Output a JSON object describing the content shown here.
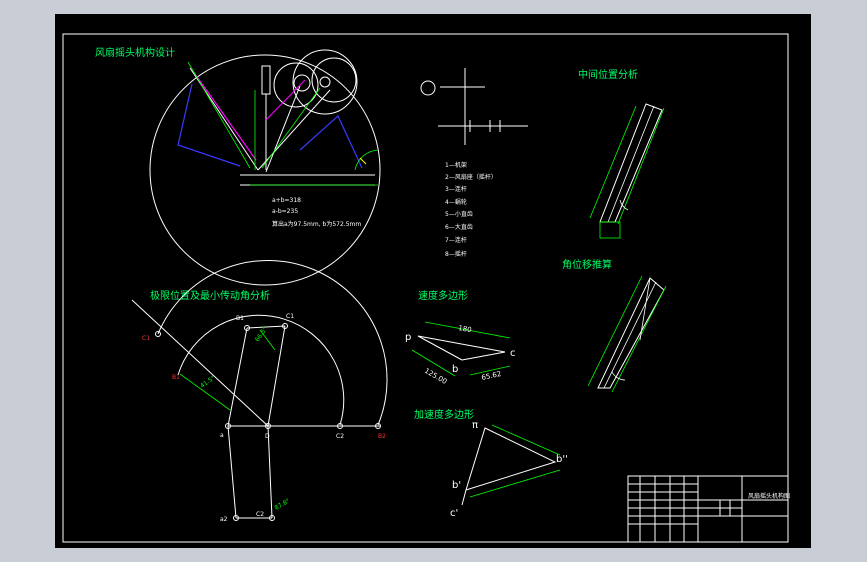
{
  "colors": {
    "background": "#c9ced6",
    "sheet": "#000000",
    "line": "#ffffff",
    "dimension": "#00ff00",
    "label_green": "#00ff66",
    "red_label": "#ff3030",
    "blue_link": "#3a3aff",
    "magenta_link": "#ff00ff",
    "yellow": "#ffff00"
  },
  "titles": {
    "main_design": "风扇摇头机构设计",
    "middle_position": "中间位置分析",
    "angular_displacement": "角位移推算",
    "limit_position": "极限位置及最小传动角分析",
    "velocity_polygon": "速度多边形",
    "acceleration_polygon": "加速度多边形"
  },
  "equations": {
    "eq1": "a+b=318",
    "eq2": "a-b=235",
    "eq3": "算出a为97.5mm, b为572.5mm"
  },
  "legend": [
    "1—机架",
    "2—风扇座（摇杆）",
    "3—连杆",
    "4—蜗轮",
    "5—小直齿",
    "6—大直齿",
    "7—连杆",
    "8—摇杆"
  ],
  "limit_labels": {
    "C1_left": "C1",
    "B1_left": "B1",
    "B1_top": "B1",
    "C1_top": "C1",
    "a": "a",
    "D": "D",
    "C2": "C2",
    "B2": "B2",
    "a2": "a2",
    "C2_bottom": "C2",
    "angle1": "66.5°",
    "angle2": "41.5°",
    "angle3": "87.8°"
  },
  "velocity": {
    "p": "p",
    "b": "b",
    "c": "c",
    "pc": "180",
    "pb": "125.00",
    "bc": "65.62"
  },
  "acceleration": {
    "pi": "π",
    "b1": "b'",
    "b2": "b''",
    "c1": "c'"
  },
  "title_block": {
    "drawing_name": "风扇摇头机构图"
  }
}
